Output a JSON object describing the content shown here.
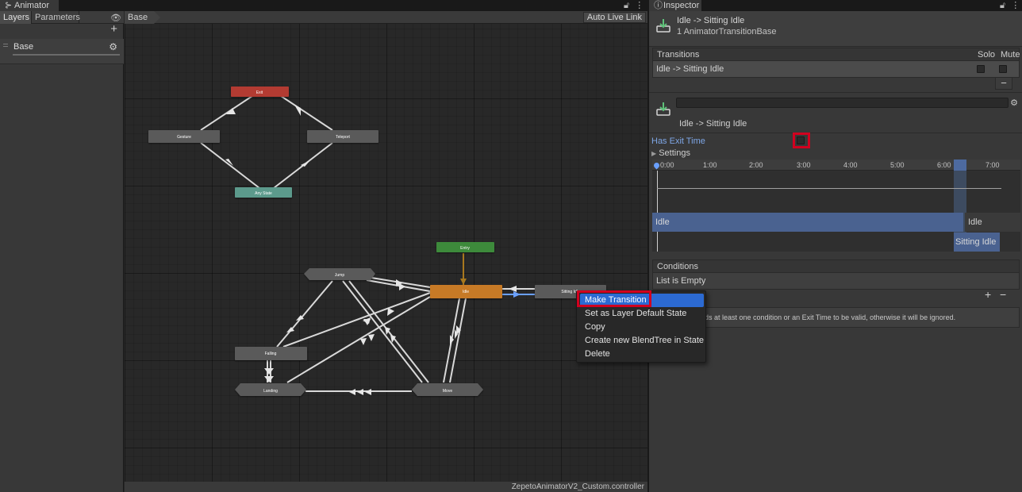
{
  "animator": {
    "window_title": "Animator",
    "tabs": {
      "layers": "Layers",
      "parameters": "Parameters"
    },
    "layers": [
      {
        "name": "Base"
      }
    ],
    "breadcrumb": "Base",
    "auto_live_link": "Auto Live Link",
    "status_file": "ZepetoAnimatorV2_Custom.controller",
    "states": {
      "exit": "Exit",
      "gesture": "Gesture",
      "teleport": "Teleport",
      "any_state": "Any State",
      "entry": "Entry",
      "jump": "Jump",
      "idle": "Idle",
      "sitting_idle": "Sitting Idle",
      "falling": "Falling",
      "landing": "Landing",
      "move": "Move"
    },
    "colors": {
      "exit": "#b33a32",
      "any_state": "#5b9a8c",
      "entry": "#3d8a3a",
      "idle": "#c77a26",
      "state": "#5a5a5a",
      "transition": "#d9d9d9",
      "selected_transition": "#6aa0ff"
    }
  },
  "context_menu": {
    "items": [
      "Make Transition",
      "Set as Layer Default State",
      "Copy",
      "Create new BlendTree in State",
      "Delete"
    ],
    "highlighted": 0
  },
  "inspector": {
    "window_title": "Inspector",
    "title": "Idle -> Sitting Idle",
    "subtitle": "1 AnimatorTransitionBase",
    "transitions_header": "Transitions",
    "solo": "Solo",
    "mute": "Mute",
    "transition_row": "Idle -> Sitting Idle",
    "transition_label": "Idle -> Sitting Idle",
    "has_exit_time_label": "Has Exit Time",
    "has_exit_time": false,
    "settings_label": "Settings",
    "timeline_ticks": [
      "0:00",
      "1:00",
      "2:00",
      "3:00",
      "4:00",
      "5:00",
      "6:00",
      "7:00"
    ],
    "timeline_source": "Idle",
    "timeline_source_after": "Idle",
    "timeline_target": "Sitting Idle",
    "conditions_header": "Conditions",
    "conditions_empty": "List is Empty",
    "warning_partial": "eeds at least one condition or an Exit Time to be valid, otherwise it will be ignored."
  }
}
